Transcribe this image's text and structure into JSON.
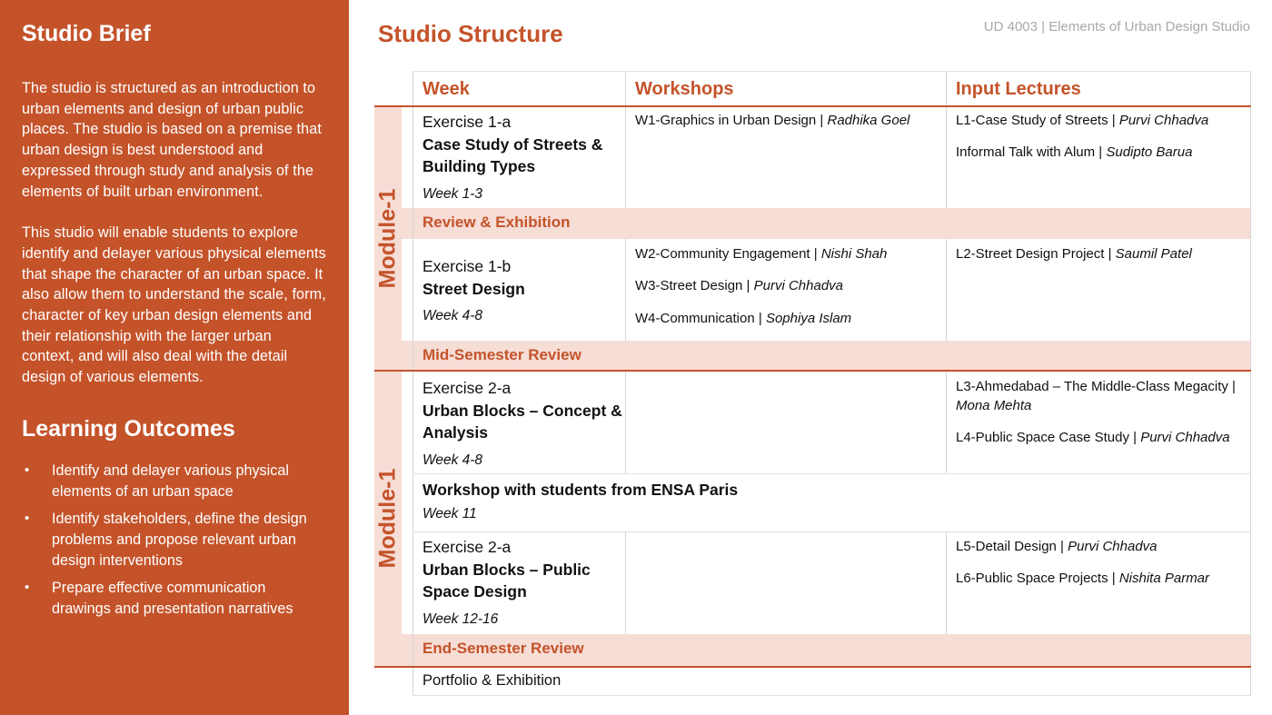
{
  "course_code": "UD 4003 | Elements of Urban Design Studio",
  "brief": {
    "title": "Studio Brief",
    "para1": "The studio is structured as an introduction to urban elements and design of urban public places. The studio is based on a premise that urban design is best understood and expressed through study and analysis of the elements of built urban environment.",
    "para2": "This studio will enable students to explore identify and delayer various physical elements that shape the character of an urban space. It also allow them to understand the scale, form, character of key urban design elements and their relationship with the larger urban context, and  will also deal with the detail design of various elements."
  },
  "outcomes": {
    "title": "Learning Outcomes",
    "bullet": "•",
    "items": [
      "Identify and delayer various physical elements of an urban space",
      "Identify stakeholders, define the design problems and propose relevant urban design interventions",
      "Prepare effective communication drawings and presentation narratives"
    ]
  },
  "structure": {
    "title": "Studio Structure",
    "headers": {
      "week": "Week",
      "workshops": "Workshops",
      "lectures": "Input Lectures"
    },
    "modules": [
      "Module-1",
      "Module-1"
    ],
    "ex1a": {
      "line1": "Exercise 1-a",
      "bold": "Case Study of Streets & Building Types",
      "week": "Week 1-3"
    },
    "ex1a_workshop": {
      "name": "W1-Graphics in Urban Design |",
      "person": "Radhika Goel"
    },
    "ex1a_lectures": [
      {
        "name": "L1-Case Study of Streets |",
        "person": "Purvi Chhadva"
      },
      {
        "name": "Informal Talk with Alum |",
        "person": "Sudipto Barua"
      }
    ],
    "review1": "Review & Exhibition",
    "ex1b": {
      "line1": "Exercise 1-b",
      "bold": "Street Design",
      "week": "Week 4-8"
    },
    "ex1b_workshops": [
      {
        "name": "W2-Community Engagement |",
        "person": "Nishi Shah"
      },
      {
        "name": "W3-Street Design |",
        "person": "Purvi Chhadva"
      },
      {
        "name": "W4-Communication |",
        "person": "Sophiya Islam"
      }
    ],
    "ex1b_lectures": [
      {
        "name": "L2-Street Design Project |",
        "person": "Saumil Patel"
      }
    ],
    "review2": "Mid-Semester Review",
    "ex2a": {
      "line1": "Exercise 2-a",
      "bold": "Urban Blocks – Concept & Analysis",
      "week": "Week 4-8"
    },
    "ex2a_lectures": [
      {
        "name": "L3-Ahmedabad – The Middle-Class Megacity |",
        "person": "Mona Mehta"
      },
      {
        "name": "L4-Public Space Case Study |",
        "person": "Purvi Chhadva"
      }
    ],
    "workshop_paris": {
      "title": "Workshop with students from ENSA Paris",
      "week": "Week 11"
    },
    "ex2b": {
      "line1": "Exercise 2-a",
      "bold": "Urban Blocks – Public Space Design",
      "week": "Week 12-16"
    },
    "ex2b_lectures": [
      {
        "name": "L5-Detail Design |",
        "person": "Purvi Chhadva"
      },
      {
        "name": "L6-Public Space Projects |",
        "person": "Nishita Parmar"
      }
    ],
    "review3": "End-Semester Review",
    "portfolio": "Portfolio & Exhibition"
  }
}
